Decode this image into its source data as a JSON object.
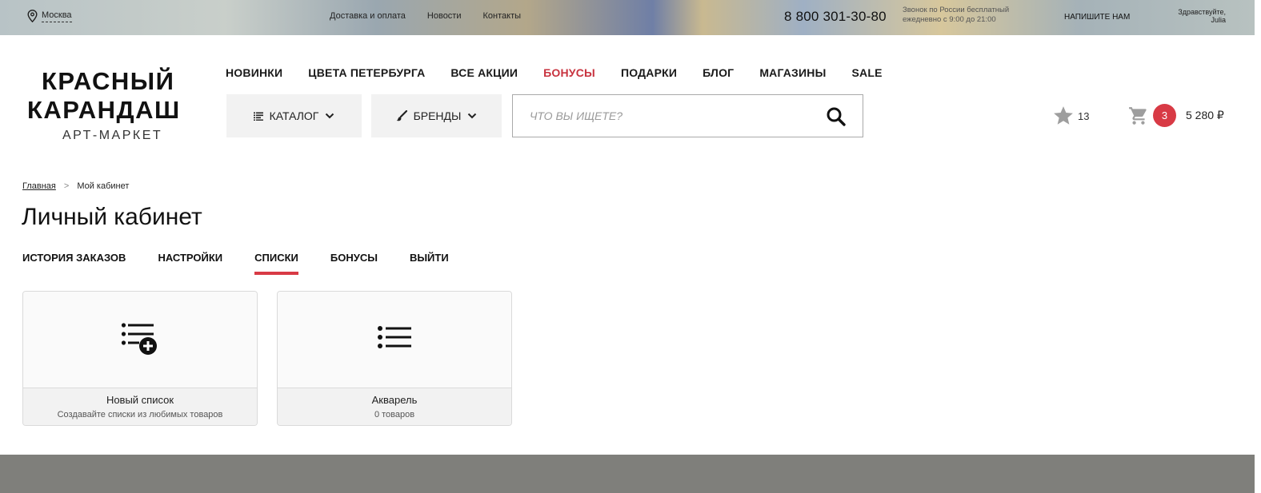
{
  "topbar": {
    "city": "Москва",
    "links": [
      "Доставка и оплата",
      "Новости",
      "Контакты"
    ],
    "phone": "8 800 301-30-80",
    "phone_note_line1": "Звонок по России бесплатный",
    "phone_note_line2": "ежедневно с 9:00 до 21:00",
    "write_us": "НАПИШИТЕ НАМ",
    "greeting": "Здравствуйте,",
    "user_name": "Julia"
  },
  "logo": {
    "line1": "КРАСНЫЙ",
    "line2": "КАРАНДАШ",
    "line3": "АРТ-МАРКЕТ",
    "accent_color": "#d83a45"
  },
  "mainnav": {
    "items": [
      "НОВИНКИ",
      "ЦВЕТА ПЕТЕРБУРГА",
      "ВСЕ АКЦИИ",
      "БОНУСЫ",
      "ПОДАРКИ",
      "БЛОГ",
      "МАГАЗИНЫ",
      "SALE"
    ],
    "highlight_color": "#c8333f"
  },
  "toolbar": {
    "catalog_label": "КАТАЛОГ",
    "brands_label": "БРЕНДЫ",
    "search_placeholder": "ЧТО ВЫ ИЩЕТЕ?"
  },
  "header_actions": {
    "favorites_count": "13",
    "cart_count": "3",
    "cart_total": "5 280 ₽"
  },
  "breadcrumb": {
    "home": "Главная",
    "separator": ">",
    "current": "Мой кабинет"
  },
  "page": {
    "title": "Личный кабинет"
  },
  "tabs": {
    "items": [
      "ИСТОРИЯ ЗАКАЗОВ",
      "НАСТРОЙКИ",
      "СПИСКИ",
      "БОНУСЫ",
      "ВЫЙТИ"
    ],
    "active": "СПИСКИ"
  },
  "lists": {
    "cards": [
      {
        "name": "Новый список",
        "subtitle": "Создавайте списки из любимых товаров",
        "icon": "list-add-icon"
      },
      {
        "name": "Акварель",
        "subtitle": "0 товаров",
        "icon": "list-icon"
      }
    ]
  }
}
